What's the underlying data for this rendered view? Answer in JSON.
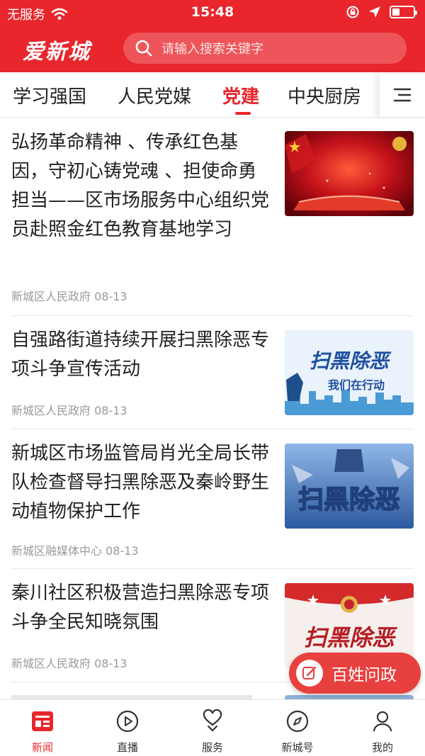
{
  "status_bar": {
    "carrier": "无服务",
    "time": "15:48"
  },
  "header": {
    "logo_text": "爱新城",
    "search_placeholder": "请输入搜索关键字"
  },
  "tabs": [
    {
      "label": "学习强国",
      "active": false
    },
    {
      "label": "人民党媒",
      "active": false
    },
    {
      "label": "党建",
      "active": true
    },
    {
      "label": "中央厨房",
      "active": false
    }
  ],
  "news": [
    {
      "title": "弘扬革命精神 、传承红色基因，守初心铸党魂 、担使命勇担当——区市场服务中心组织党员赴照金红色教育基地学习",
      "source": "新城区人民政府",
      "date": "08-13",
      "thumb": "red-party-banner"
    },
    {
      "title": "自强路街道持续开展扫黑除恶专项斗争宣传活动",
      "source": "新城区人民政府",
      "date": "08-13",
      "thumb": "saohei-action-poster",
      "thumb_text": "扫黑除恶",
      "thumb_subtext": "我们在行动"
    },
    {
      "title": "新城区市场监管局肖光全局长带队检查督导扫黑除恶及秦岭野生动植物保护工作",
      "source": "新城区融媒体中心",
      "date": "08-13",
      "thumb": "saohei-fist-poster",
      "thumb_text": "扫黑除恶"
    },
    {
      "title": "秦川社区积极营造扫黑除恶专项斗争全民知晓氛围",
      "source": "新城区人民政府",
      "date": "08-13",
      "thumb": "saohei-emblem-poster",
      "thumb_text": "扫黑除恶"
    }
  ],
  "float_button": {
    "label": "百姓问政"
  },
  "bottom_nav": [
    {
      "label": "新闻",
      "icon": "news-icon",
      "active": true
    },
    {
      "label": "直播",
      "icon": "play-icon",
      "active": false
    },
    {
      "label": "服务",
      "icon": "service-icon",
      "active": false
    },
    {
      "label": "新城号",
      "icon": "compass-icon",
      "active": false
    },
    {
      "label": "我的",
      "icon": "user-icon",
      "active": false
    }
  ],
  "colors": {
    "brand_red": "#e8262c",
    "meta_gray": "#9a9a9a"
  }
}
